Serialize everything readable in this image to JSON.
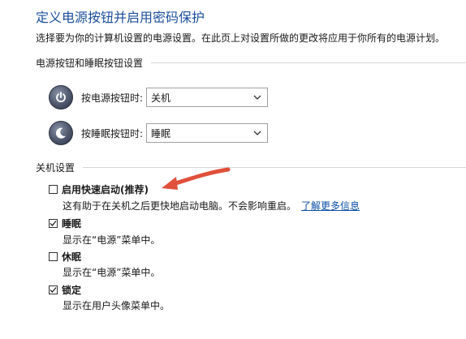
{
  "title": "定义电源按钮并启用密码保护",
  "description": "选择要为你的计算机设置的电源设置。在此页上对设置所做的更改将应用于你所有的电源计划。",
  "power_section": {
    "header": "电源按钮和睡眠按钮设置",
    "rows": [
      {
        "label": "按电源按钮时:",
        "value": "关机",
        "icon": "power-icon"
      },
      {
        "label": "按睡眠按钮时:",
        "value": "睡眠",
        "icon": "sleep-moon-icon"
      }
    ]
  },
  "shutdown_section": {
    "header": "关机设置",
    "options": [
      {
        "label": "启用快速启动(推荐)",
        "checked": false,
        "desc": "这有助于在关机之后更快地启动电脑。不会影响重启。",
        "link": "了解更多信息"
      },
      {
        "label": "睡眠",
        "checked": true,
        "desc": "显示在“电源”菜单中。"
      },
      {
        "label": "休眠",
        "checked": false,
        "desc": "显示在“电源”菜单中。"
      },
      {
        "label": "锁定",
        "checked": true,
        "desc": "显示在用户头像菜单中。"
      }
    ]
  },
  "annotation_color": "#e0503a"
}
